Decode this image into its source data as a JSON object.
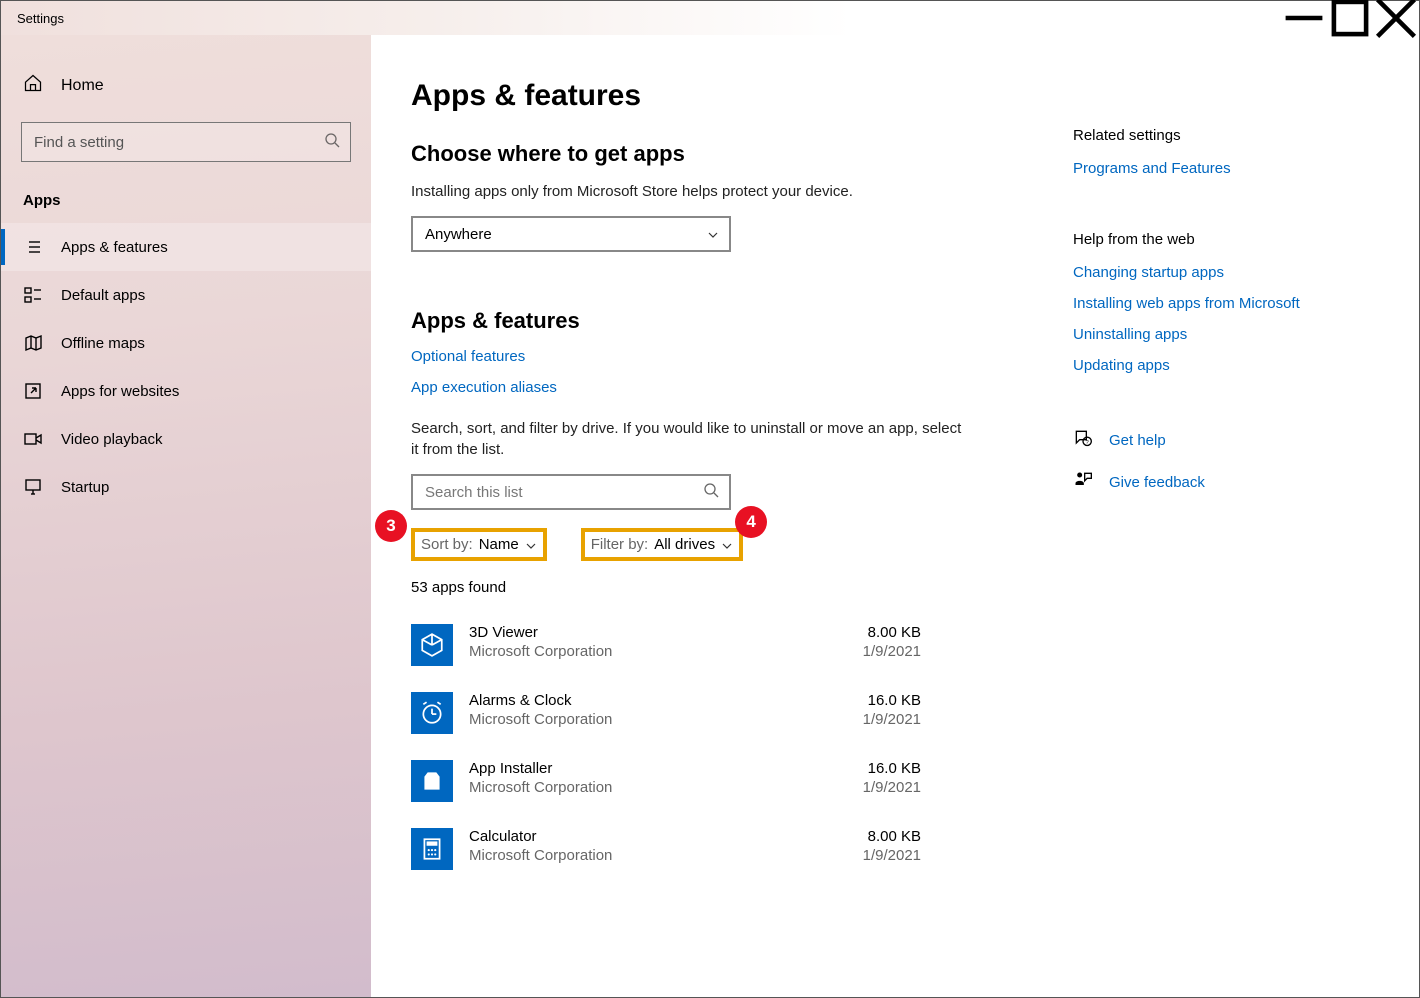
{
  "window": {
    "title": "Settings"
  },
  "sidebar": {
    "home": "Home",
    "search_placeholder": "Find a setting",
    "section": "Apps",
    "items": [
      {
        "label": "Apps & features",
        "active": true
      },
      {
        "label": "Default apps"
      },
      {
        "label": "Offline maps"
      },
      {
        "label": "Apps for websites"
      },
      {
        "label": "Video playback"
      },
      {
        "label": "Startup"
      }
    ]
  },
  "main": {
    "title": "Apps & features",
    "choose_heading": "Choose where to get apps",
    "choose_desc": "Installing apps only from Microsoft Store helps protect your device.",
    "source_value": "Anywhere",
    "sub_heading": "Apps & features",
    "link_optional": "Optional features",
    "link_aliases": "App execution aliases",
    "filter_desc": "Search, sort, and filter by drive. If you would like to uninstall or move an app, select it from the list.",
    "searchlist_placeholder": "Search this list",
    "sort_label": "Sort by:",
    "sort_value": "Name",
    "filter_label": "Filter by:",
    "filter_value": "All drives",
    "badge3": "3",
    "badge4": "4",
    "count_text": "53 apps found",
    "apps": [
      {
        "name": "3D Viewer",
        "publisher": "Microsoft Corporation",
        "size": "8.00 KB",
        "date": "1/9/2021"
      },
      {
        "name": "Alarms & Clock",
        "publisher": "Microsoft Corporation",
        "size": "16.0 KB",
        "date": "1/9/2021"
      },
      {
        "name": "App Installer",
        "publisher": "Microsoft Corporation",
        "size": "16.0 KB",
        "date": "1/9/2021"
      },
      {
        "name": "Calculator",
        "publisher": "Microsoft Corporation",
        "size": "8.00 KB",
        "date": "1/9/2021"
      }
    ]
  },
  "right": {
    "related_h": "Related settings",
    "related_link": "Programs and Features",
    "help_h": "Help from the web",
    "help_links": [
      "Changing startup apps",
      "Installing web apps from Microsoft",
      "Uninstalling apps",
      "Updating apps"
    ],
    "gethelp": "Get help",
    "feedback": "Give feedback"
  }
}
